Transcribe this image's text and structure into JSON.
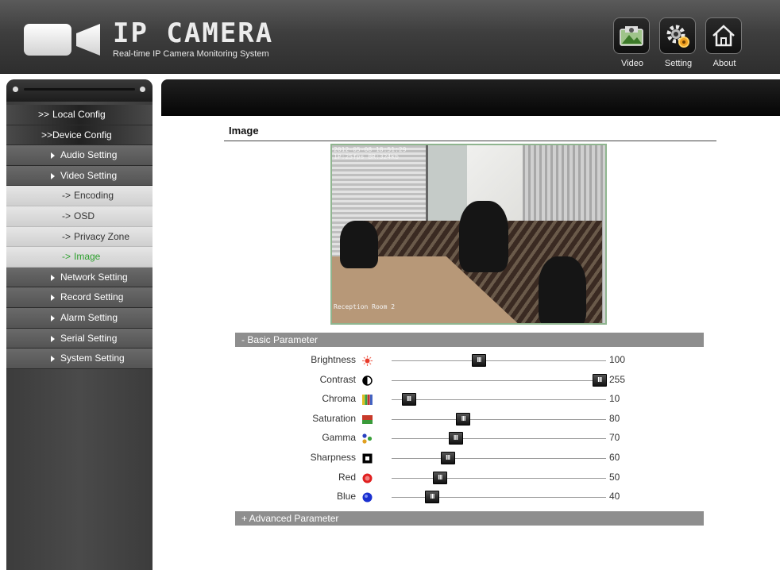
{
  "header": {
    "title": "IP CAMERA",
    "subtitle": "Real-time IP Camera Monitoring System",
    "buttons": {
      "video": "Video",
      "setting": "Setting",
      "about": "About"
    }
  },
  "sidebar": {
    "local_config": "Local Config",
    "device_config": "Device Config",
    "audio_setting": "Audio Setting",
    "video_setting": "Video Setting",
    "encoding": "Encoding",
    "osd": "OSD",
    "privacy_zone": "Privacy Zone",
    "image": "Image",
    "network_setting": "Network Setting",
    "record_setting": "Record Setting",
    "alarm_setting": "Alarm Setting",
    "serial_setting": "Serial Setting",
    "system_setting": "System Setting",
    "chevron": ">>",
    "arrow": "->"
  },
  "main": {
    "section_title": "Image",
    "preview": {
      "osd_line1": "2012-05-08 18:51:29",
      "osd_line2": "1P:25fps BR:324kb",
      "location": "Reception Room 2"
    },
    "basic_section": "- Basic Parameter",
    "advanced_section": "+ Advanced Parameter",
    "slider_max": 255,
    "parameters": [
      {
        "name": "Brightness",
        "value": 100,
        "icon": "brightness-icon"
      },
      {
        "name": "Contrast",
        "value": 255,
        "icon": "contrast-icon"
      },
      {
        "name": "Chroma",
        "value": 10,
        "icon": "chroma-icon"
      },
      {
        "name": "Saturation",
        "value": 80,
        "icon": "saturation-icon"
      },
      {
        "name": "Gamma",
        "value": 70,
        "icon": "gamma-icon"
      },
      {
        "name": "Sharpness",
        "value": 60,
        "icon": "sharpness-icon"
      },
      {
        "name": "Red",
        "value": 50,
        "icon": "red-icon"
      },
      {
        "name": "Blue",
        "value": 40,
        "icon": "blue-icon"
      }
    ],
    "slider_thumb_glyph": "III"
  }
}
